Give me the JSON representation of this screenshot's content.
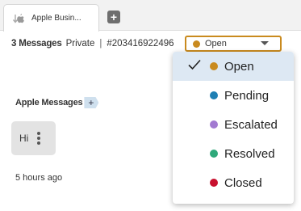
{
  "tabs": [
    {
      "label": "Apple Busin...",
      "icon": "apple-icon"
    }
  ],
  "add_tab": {
    "icon": "plus-icon",
    "label": "+"
  },
  "header": {
    "message_count": "3 Messages",
    "privacy": "Private",
    "separator": "|",
    "conversation_id": "#203416922496"
  },
  "status_select": {
    "value": "Open",
    "dot_color": "#c98a1e",
    "border_color": "#c98a1e",
    "icon": "caret-down-icon"
  },
  "status_options": [
    {
      "label": "Open",
      "color": "#c98a1e",
      "selected": true
    },
    {
      "label": "Pending",
      "color": "#1f7fb3",
      "selected": false
    },
    {
      "label": "Escalated",
      "color": "#a27ad1",
      "selected": false
    },
    {
      "label": "Resolved",
      "color": "#2ea87a",
      "selected": false
    },
    {
      "label": "Closed",
      "color": "#c8102e",
      "selected": false
    }
  ],
  "channel": {
    "label": "Apple Messages",
    "plus": "+"
  },
  "message": {
    "text": "Hi",
    "menu_icon": "kebab-menu-icon"
  },
  "timestamp": "5 hours ago"
}
